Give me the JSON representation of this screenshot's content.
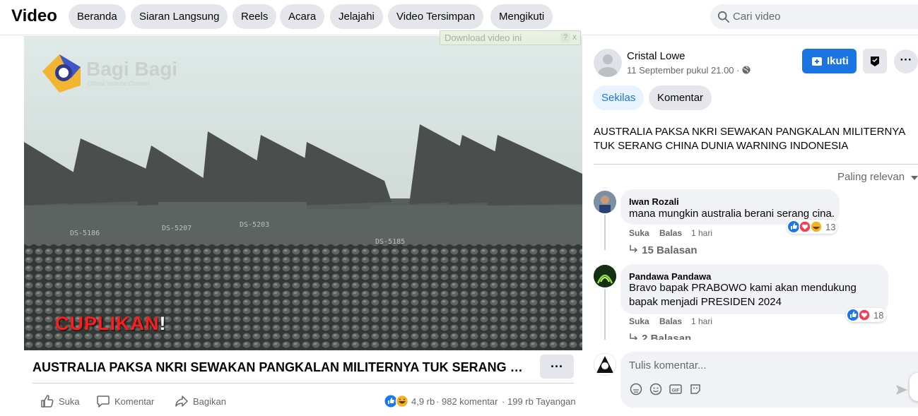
{
  "header": {
    "title": "Video",
    "nav": [
      "Beranda",
      "Siaran Langsung",
      "Reels",
      "Acara",
      "Jelajahi",
      "Video Tersimpan",
      "Mengikuti"
    ],
    "search_placeholder": "Cari video"
  },
  "video": {
    "download_label": "Download video ini",
    "download_help": "?",
    "download_close": "x",
    "watermark": "Bagi Bagi",
    "watermark_sub": "Official Youtube Channel",
    "overlay_text_red": "CUPLIKAN",
    "overlay_text_white": "!",
    "title": "AUSTRALIA PAKSA NKRI SEWAKAN PANGKALAN MILITERNYA TUK SERANG CHINA DUNIA WARNING INDONESIA",
    "more_label": "···",
    "actions": {
      "like": "Suka",
      "comment": "Komentar",
      "share": "Bagikan"
    },
    "stats": {
      "reactions": "4,9 rb",
      "comments": "982 komentar",
      "views": "199 rb Tayangan"
    }
  },
  "poster": {
    "name": "Cristal Lowe",
    "date": "11 September pukul 21.00 · ",
    "follow_label": "Ikuti",
    "more_label": "···"
  },
  "tabs": {
    "overview": "Sekilas",
    "comments": "Komentar"
  },
  "description": "AUSTRALIA PAKSA NKRI SEWAKAN PANGKALAN MILITERNYA TUK SERANG CHINA DUNIA WARNING INDONESIA",
  "sort_label": "Paling relevan",
  "comments": [
    {
      "author": "Iwan Rozali",
      "text": "mana mungkin australia berani serang cina.",
      "like": "Suka",
      "reply": "Balas",
      "time": "1 hari",
      "reaction_count": "13",
      "replies": "15 Balasan"
    },
    {
      "author": "Pandawa Pandawa",
      "text_line1": "Bravo bapak PRABOWO kami akan mendukung",
      "text_line2": "bapak menjadi PRESIDEN 2024",
      "like": "Suka",
      "reply": "Balas",
      "time": "1 hari",
      "reaction_count": "18",
      "replies": "2 Balasan"
    }
  ],
  "composer": {
    "placeholder": "Tulis komentar..."
  },
  "colors": {
    "accent": "#1b74e4",
    "like_blue": "#1877f2",
    "love_red": "#f33e58",
    "haha_yellow": "#f7b125"
  },
  "icons": [
    "search-icon",
    "like-icon",
    "comment-icon",
    "share-icon",
    "globe-icon",
    "follow-icon",
    "save-icon",
    "reply-arrow-icon",
    "sticker-icon",
    "emoji-icon",
    "gif-icon",
    "send-icon"
  ]
}
